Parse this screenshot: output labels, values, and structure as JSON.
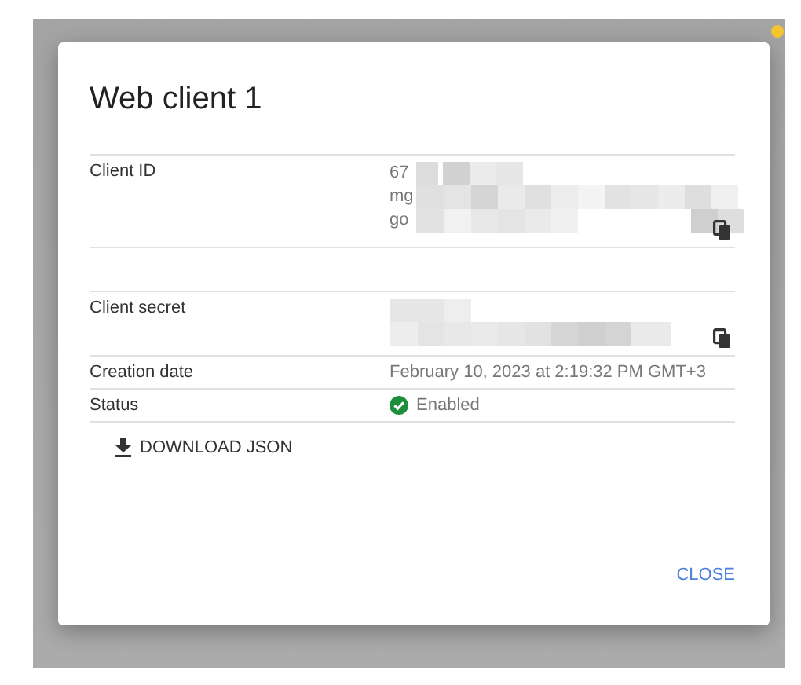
{
  "dialog": {
    "title": "Web client 1",
    "rows": [
      {
        "kind": "secret",
        "label": "Client ID",
        "lines": [
          "67",
          "mg",
          "go"
        ],
        "copyable": true
      },
      {
        "kind": "spacer"
      },
      {
        "kind": "secret",
        "label": "Client secret",
        "copyable": true
      },
      {
        "kind": "text",
        "label": "Creation date",
        "value": "February 10, 2023 at 2:19:32 PM GMT+3"
      },
      {
        "kind": "status",
        "label": "Status",
        "value": "Enabled",
        "enabled": true
      }
    ],
    "download_button": "DOWNLOAD JSON",
    "close_button": "CLOSE"
  }
}
